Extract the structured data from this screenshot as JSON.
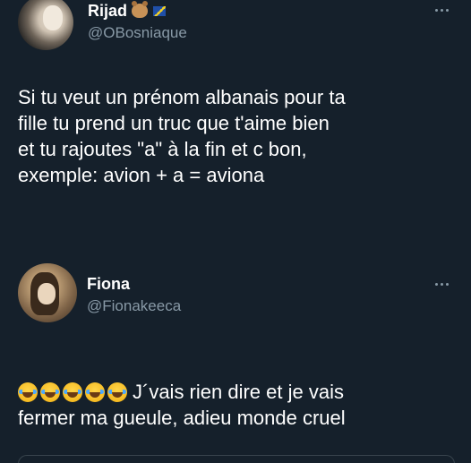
{
  "tweets": [
    {
      "display_name": "Rijad",
      "handle": "@OBosniaque",
      "name_badges": [
        "bear-face-icon",
        "bosnia-flag-icon"
      ],
      "text": "Si tu veut un prénom albanais pour ta\nfille tu prend un truc que t'aime bien\net tu rajoutes \"a\" à la fin et c bon,\nexemple: avion + a = aviona"
    },
    {
      "display_name": "Fiona",
      "handle": "@Fionakeeca",
      "emoji_prefix": [
        "tears-of-joy-icon",
        "tears-of-joy-icon",
        "tears-of-joy-icon",
        "tears-of-joy-icon",
        "tears-of-joy-icon"
      ],
      "text": "J´vais rien dire et je vais\nfermer ma gueule, adieu monde cruel"
    }
  ],
  "colors": {
    "background": "#15202b",
    "primary_text": "#ffffff",
    "secondary_text": "#8899a6"
  }
}
